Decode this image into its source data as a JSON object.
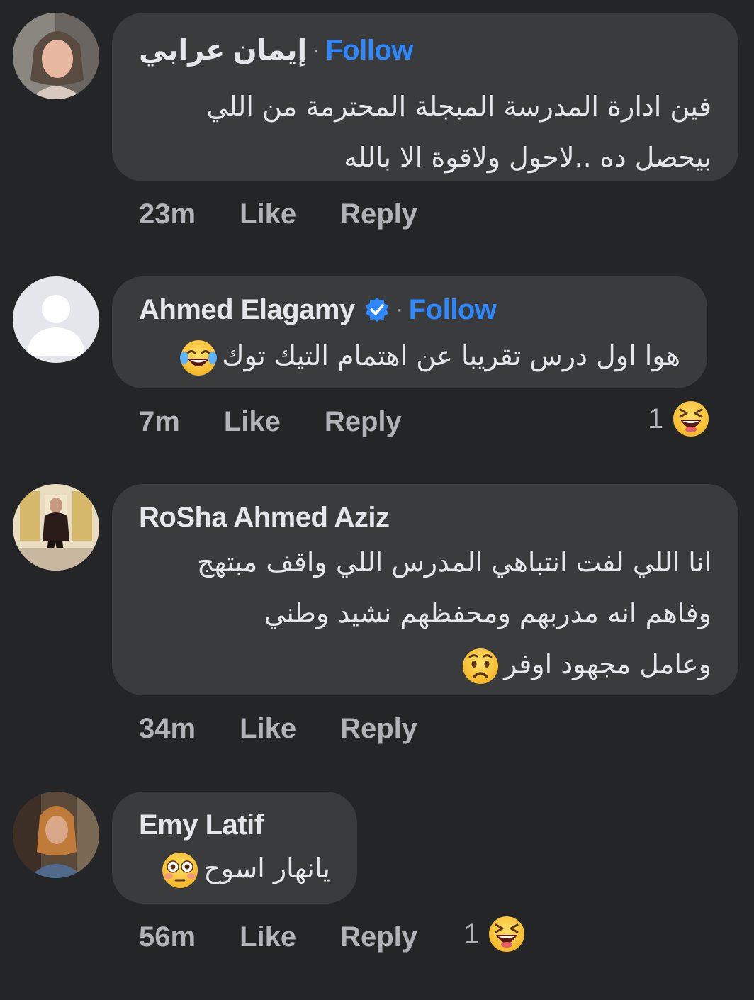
{
  "comments": [
    {
      "author": "إيمان عرابي",
      "separator": "·",
      "follow_label": "Follow",
      "verified": false,
      "lines": [
        "فين ادارة المدرسة المبجلة المحترمة من اللي",
        "بيحصل ده ..لاحول ولاقوة الا بالله"
      ],
      "time": "23m",
      "like_label": "Like",
      "reply_label": "Reply"
    },
    {
      "author": "Ahmed Elagamy",
      "separator": "·",
      "follow_label": "Follow",
      "verified": true,
      "lines": [
        "هوا اول درس تقريبا عن اهتمام التيك توك"
      ],
      "line_emoji": "tears-of-joy-emoji",
      "time": "7m",
      "like_label": "Like",
      "reply_label": "Reply",
      "reaction_count": "1",
      "reaction_emoji": "laughing-emoji"
    },
    {
      "author": "RoSha Ahmed Aziz",
      "verified": false,
      "lines": [
        "انا اللي لفت انتباهي المدرس اللي واقف مبتهج",
        "وفاهم انه مدربهم ومحفظهم نشيد وطني",
        "وعامل مجهود اوفر"
      ],
      "line_emoji": "worried-face-emoji",
      "time": "34m",
      "like_label": "Like",
      "reply_label": "Reply"
    },
    {
      "author": "Emy Latif",
      "verified": false,
      "lines": [
        "يانهار اسوح"
      ],
      "line_emoji": "flushed-face-emoji",
      "time": "56m",
      "like_label": "Like",
      "reply_label": "Reply",
      "reaction_count": "1",
      "reaction_emoji": "laughing-emoji"
    }
  ],
  "colors": {
    "background": "#242527",
    "bubble": "#3a3b3c",
    "text": "#e4e6eb",
    "muted": "#b0b3b8",
    "link": "#2d88ff"
  }
}
